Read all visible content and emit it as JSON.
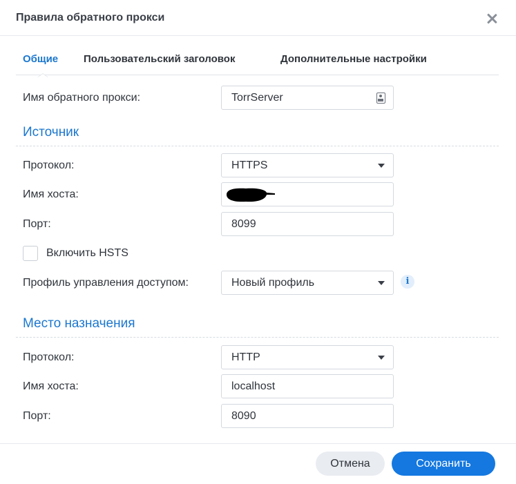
{
  "dialog": {
    "title": "Правила обратного прокси",
    "close_icon": "close-icon"
  },
  "tabs": [
    {
      "label": "Общие",
      "active": true
    },
    {
      "label": "Пользовательский заголовок",
      "active": false
    },
    {
      "label": "Дополнительные настройки",
      "active": false
    }
  ],
  "general": {
    "name_label": "Имя обратного прокси:",
    "name_value": "TorrServer",
    "name_icon": "keyboard-icon"
  },
  "source": {
    "heading": "Источник",
    "protocol_label": "Протокол:",
    "protocol_value": "HTTPS",
    "hostname_label": "Имя хоста:",
    "hostname_value": "",
    "hostname_redacted": true,
    "port_label": "Порт:",
    "port_value": "8099",
    "hsts_label": "Включить HSTS",
    "hsts_checked": false,
    "access_profile_label": "Профиль управления доступом:",
    "access_profile_value": "Новый профиль",
    "info_glyph": "i"
  },
  "destination": {
    "heading": "Место назначения",
    "protocol_label": "Протокол:",
    "protocol_value": "HTTP",
    "hostname_label": "Имя хоста:",
    "hostname_value": "localhost",
    "port_label": "Порт:",
    "port_value": "8090"
  },
  "footer": {
    "cancel_label": "Отмена",
    "save_label": "Сохранить"
  },
  "colors": {
    "accent": "#1b77cf",
    "primary_button": "#1478e0",
    "secondary_button": "#e9ecf1"
  }
}
